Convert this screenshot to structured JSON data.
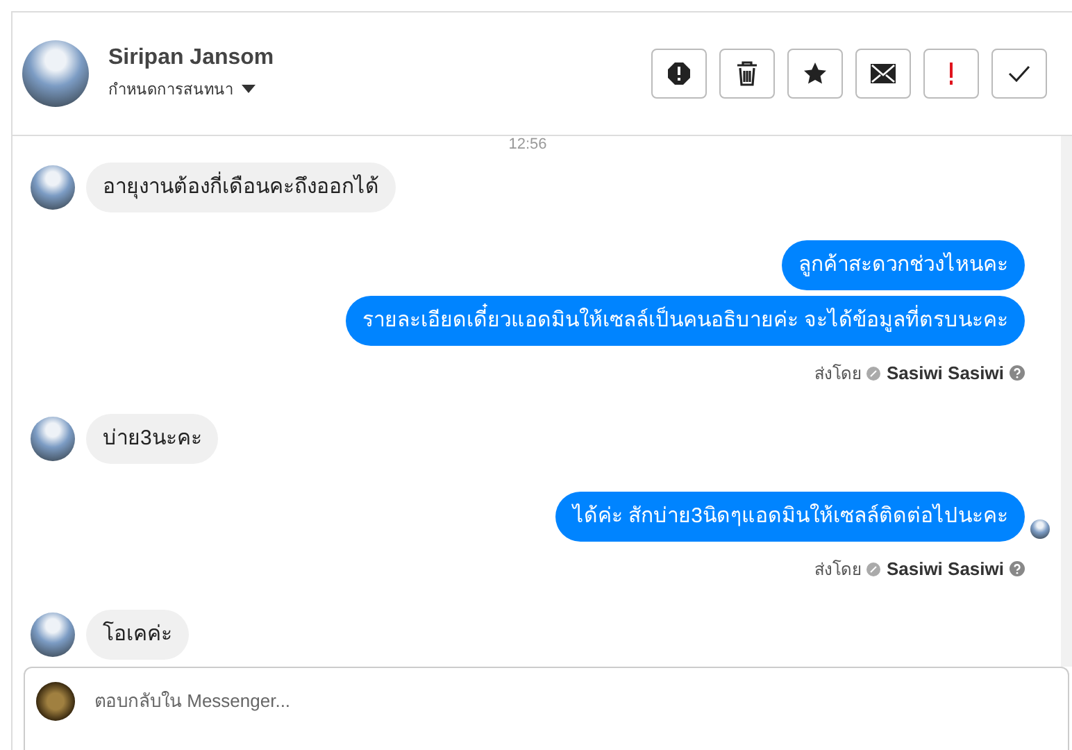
{
  "header": {
    "name": "Siripan Jansom",
    "subtitle": "กำหนดการสนทนา"
  },
  "messages": [
    {
      "kind": "time",
      "text": "12:56"
    },
    {
      "kind": "incoming",
      "texts": [
        "อายุงานต้องกี่เดือนคะถึงออกได้"
      ]
    },
    {
      "kind": "outgoing",
      "texts": [
        "ลูกค้าสะดวกช่วงไหนคะ",
        "รายละเอียดเดี๋ยวแอดมินให้เซลล์เป็นคนอธิบายค่ะ จะได้ข้อมูลที่ตรบนะคะ"
      ],
      "sent_by": "ส่งโดย",
      "sender": "Sasiwi Sasiwi",
      "seen": false
    },
    {
      "kind": "incoming",
      "texts": [
        "บ่าย3นะคะ"
      ]
    },
    {
      "kind": "outgoing",
      "texts": [
        "ได้ค่ะ สักบ่าย3นิดๆแอดมินให้เซลล์ติดต่อไปนะคะ"
      ],
      "sent_by": "ส่งโดย",
      "sender": "Sasiwi Sasiwi",
      "seen": true
    },
    {
      "kind": "incoming",
      "texts": [
        "โอเคค่ะ"
      ]
    }
  ],
  "composer": {
    "placeholder": "ตอบกลับใน Messenger..."
  }
}
